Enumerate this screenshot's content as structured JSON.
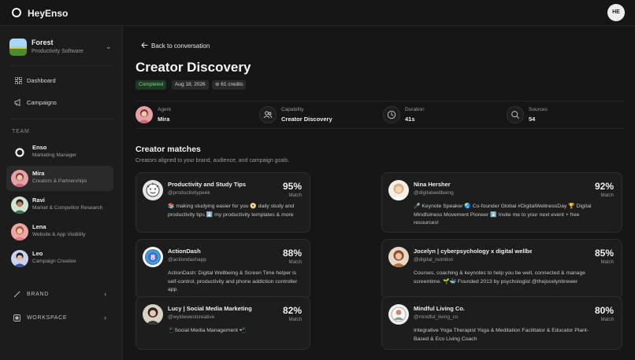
{
  "app": {
    "name": "HeyEnso",
    "user_initials": "HE"
  },
  "workspace": {
    "name": "Forest",
    "subtitle": "Productivity Software"
  },
  "nav": [
    {
      "label": "Dashboard",
      "icon": "grid-icon"
    },
    {
      "label": "Campaigns",
      "icon": "megaphone-icon"
    }
  ],
  "team": {
    "label": "TEAM",
    "members": [
      {
        "name": "Enso",
        "role": "Marketing Manager",
        "avatar": "enso-logo"
      },
      {
        "name": "Mira",
        "role": "Creators & Partnerships",
        "avatar": "mira"
      },
      {
        "name": "Ravi",
        "role": "Market & Competitor Research",
        "avatar": "ravi"
      },
      {
        "name": "Lena",
        "role": "Website & App Visibility",
        "avatar": "lena"
      },
      {
        "name": "Leo",
        "role": "Campaign Creative",
        "avatar": "leo"
      }
    ]
  },
  "groups": [
    {
      "label": "BRAND",
      "icon": "brush-icon"
    },
    {
      "label": "WORKSPACE",
      "icon": "workspace-icon"
    }
  ],
  "main": {
    "back_label": "Back to conversation",
    "title": "Creator Discovery",
    "badges": {
      "status": "Completed",
      "date": "Aug 18, 2026",
      "credits": "61 credits"
    },
    "meta": [
      {
        "label": "Agent",
        "value": "Mira",
        "icon": "mira-avatar"
      },
      {
        "label": "Capability",
        "value": "Creator Discovery",
        "icon": "people-icon"
      },
      {
        "label": "Duration",
        "value": "41s",
        "icon": "clock-icon"
      },
      {
        "label": "Sources",
        "value": "54",
        "icon": "search-icon"
      }
    ],
    "section_title": "Creator matches",
    "section_sub": "Creators aligned to your brand, audience, and campaign goals.",
    "match_label": "Match",
    "creators": [
      {
        "name": "Productivity and Study Tips",
        "handle": "@productivitypeek",
        "match": "95%",
        "desc": "📚 making studying easier for you 📀 daily study and productivity tips ⬇️ my productivity templates & more"
      },
      {
        "name": "Nina Hersher",
        "handle": "@digitalwellbeing",
        "match": "92%",
        "desc": "🎤 Keynote Speaker 🌏 Co-founder Global #DigitalWellnessDay 🏆 Digital Mindfulness Movement Pioneer ⬇️ Invite me to your next event + free resources!"
      },
      {
        "name": "ActionDash",
        "handle": "@actiondashapp",
        "match": "88%",
        "desc": "ActionDash: Digital Wellbeing & Screen Time helper is self-control, productivity and phone addiction controller app."
      },
      {
        "name": "Jocelyn | cyberpsychology x digital wellbeing",
        "handle": "@digital_nutrition",
        "match": "85%",
        "desc": "Courses, coaching & keynotes to help you be well, connected & manage screentime. 🌱🐳 Founded 2013 by psychologist @thejocelynbrewer"
      },
      {
        "name": "Lucy | Social Media Marketing",
        "handle": "@wyldewestcreative",
        "match": "82%",
        "desc": "📱Social Media Management 📲"
      },
      {
        "name": "Mindful Living Co.",
        "handle": "@mindful_living_co",
        "match": "80%",
        "desc": "Integrative Yoga Therapist Yoga & Meditation Facilitator & Educator Plant-Based & Eco Living Coach"
      }
    ]
  },
  "colors": {
    "background": "#161616",
    "sidebar": "#1c1c1c",
    "card": "#1d1d1d",
    "status_green": "#7bd48e"
  }
}
